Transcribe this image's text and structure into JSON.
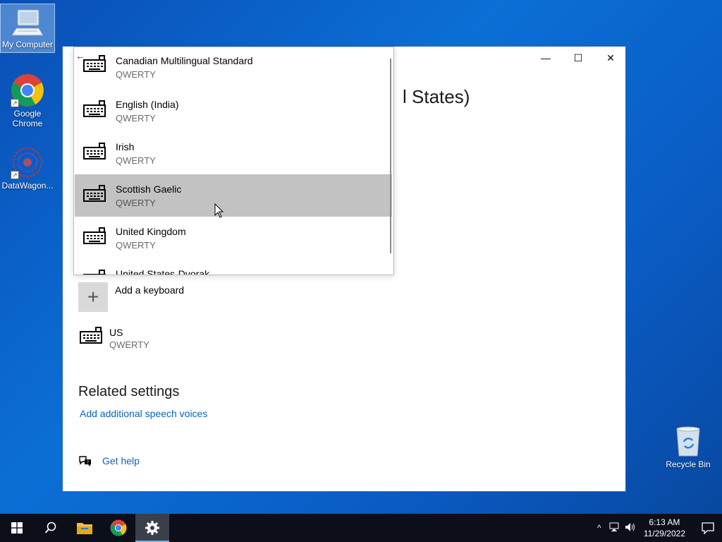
{
  "desktop": {
    "icons": [
      {
        "label": "My Computer"
      },
      {
        "label": "Google Chrome"
      },
      {
        "label": "DataWagon..."
      }
    ],
    "recycle_bin": "Recycle Bin"
  },
  "window": {
    "controls": {
      "minimize": "—",
      "maximize": "☐",
      "close": "✕"
    },
    "heading_partial": "l States)",
    "add_keyboard_label": "Add a keyboard",
    "installed_keyboard": {
      "name": "US",
      "layout": "QWERTY"
    },
    "related_settings_title": "Related settings",
    "speech_link": "Add additional speech voices",
    "help_link": "Get help"
  },
  "popup": {
    "back_icon": "←",
    "items": [
      {
        "name": "Canadian Multilingual Standard",
        "layout": "QWERTY"
      },
      {
        "name": "English (India)",
        "layout": "QWERTY"
      },
      {
        "name": "Irish",
        "layout": "QWERTY"
      },
      {
        "name": "Scottish Gaelic",
        "layout": "QWERTY",
        "hovered": true
      },
      {
        "name": "United Kingdom",
        "layout": "QWERTY"
      },
      {
        "name": "United States-Dvorak",
        "layout": ""
      }
    ]
  },
  "taskbar": {
    "time": "6:13 AM",
    "date": "11/29/2022",
    "tray_chevron": "^"
  },
  "colors": {
    "accent": "#0a64b4",
    "hover": "#c2c2c2",
    "taskbar": "#0c0f1a"
  }
}
